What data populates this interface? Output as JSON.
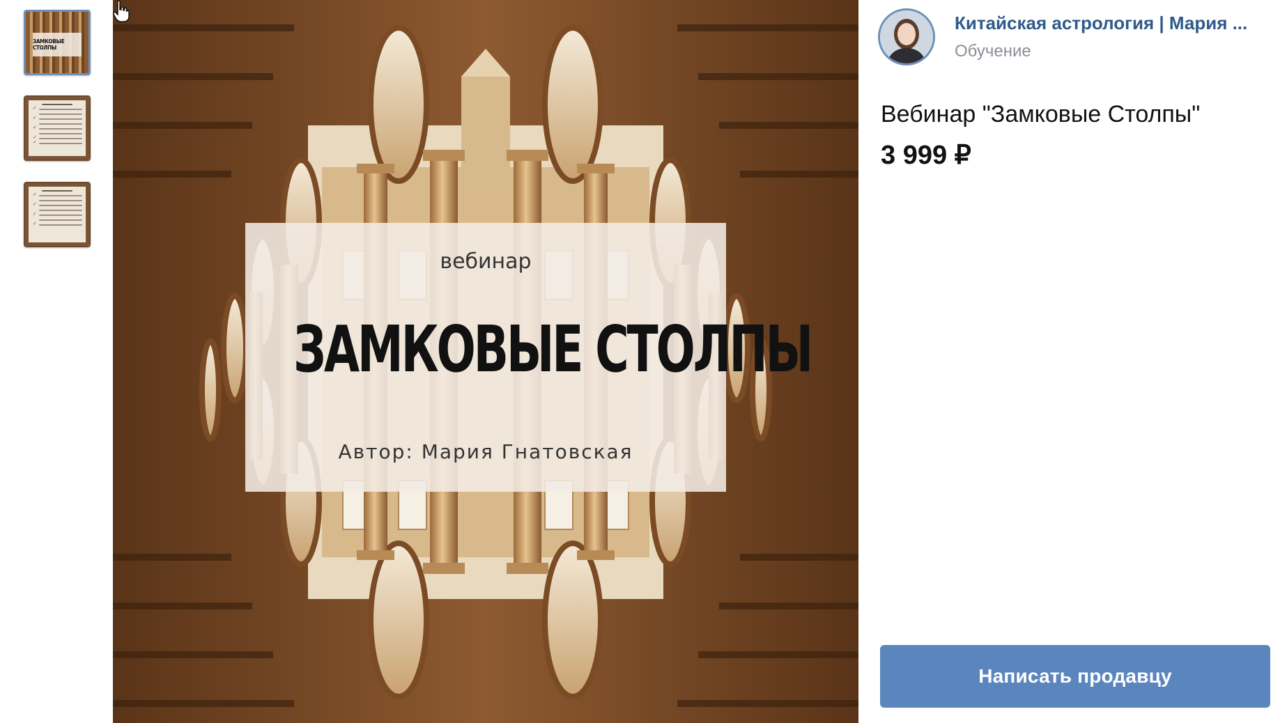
{
  "gallery": {
    "thumbnails": [
      {
        "label": "ЗАМКОВЫЕ СТОЛПЫ",
        "active": true
      },
      {
        "active": false
      },
      {
        "active": false
      }
    ]
  },
  "cover": {
    "subtitle": "вебинар",
    "title": "ЗАМКОВЫЕ СТОЛПЫ",
    "author": "Автор: Мария Гнатовская"
  },
  "seller": {
    "name": "Китайская астрология | Мария ...",
    "category": "Обучение"
  },
  "product": {
    "title": "Вебинар \"Замковые Столпы\"",
    "price": "3 999 ₽"
  },
  "actions": {
    "contact_label": "Написать продавцу"
  },
  "colors": {
    "accent": "#5b86bd",
    "link": "#2f5a8a",
    "muted": "#8a8f96"
  }
}
